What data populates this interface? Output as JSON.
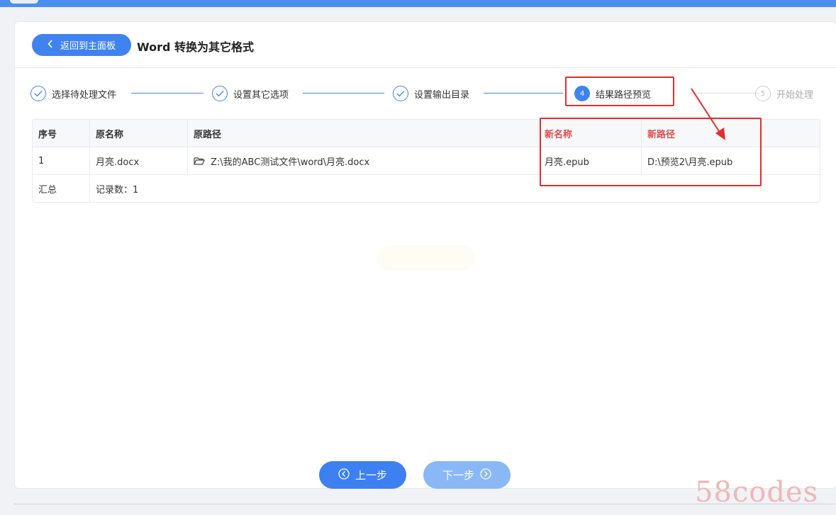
{
  "header": {
    "back_label": "返回到主面板",
    "title": "Word 转换为其它格式"
  },
  "steps": [
    {
      "label": "选择待处理文件",
      "state": "done"
    },
    {
      "label": "设置其它选项",
      "state": "done"
    },
    {
      "label": "设置输出目录",
      "state": "done"
    },
    {
      "label": "结果路径预览",
      "state": "active",
      "number": "4"
    },
    {
      "label": "开始处理",
      "state": "pending",
      "number": "5"
    }
  ],
  "table": {
    "columns": [
      "序号",
      "原名称",
      "原路径",
      "新名称",
      "新路径"
    ],
    "rows": [
      {
        "index": "1",
        "orig_name": "月亮.docx",
        "orig_path": "Z:\\我的ABC测试文件\\word\\月亮.docx",
        "new_name": "月亮.epub",
        "new_path": "D:\\预览2\\月亮.epub"
      }
    ],
    "summary": {
      "label": "汇总",
      "value": "记录数：1"
    }
  },
  "footer": {
    "prev_label": "上一步",
    "next_label": "下一步"
  },
  "watermark": "58codes",
  "colors": {
    "accent": "#4083f0",
    "highlight": "#e0302f"
  }
}
